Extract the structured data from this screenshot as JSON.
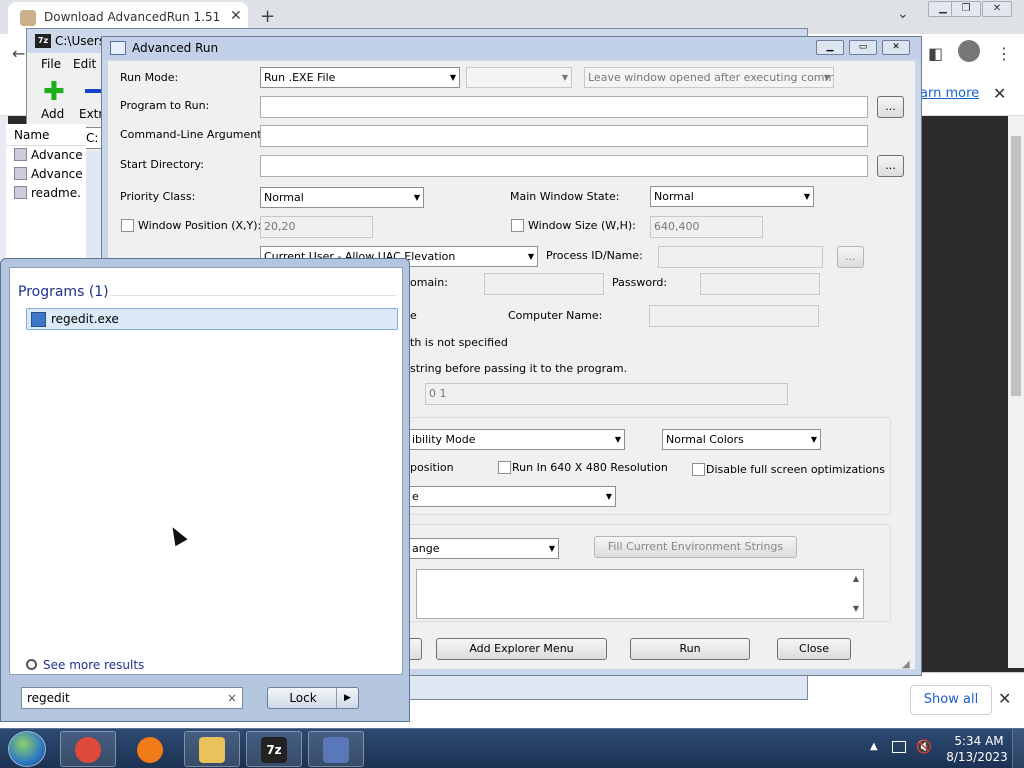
{
  "chrome": {
    "tab_title": "Download AdvancedRun 1.51",
    "tab_close": "✕",
    "new_tab": "+",
    "tab_search": "⌄",
    "infobar_link": "earn more",
    "infobar_close": "✕",
    "show_all": "Show all",
    "shelf_close": "✕"
  },
  "zip": {
    "title": "C:\\Users\\",
    "menu": [
      "File",
      "Edit"
    ],
    "add_label": "Add",
    "extract_label": "Extra",
    "path": "C:",
    "col_name": "Name",
    "files": [
      "Advance",
      "Advance",
      "readme."
    ]
  },
  "advanced_run": {
    "title": "Advanced Run",
    "run_mode_label": "Run Mode:",
    "run_mode_value": "Run .EXE File",
    "after_exec_value": "Leave window opened after executing comman",
    "program_label": "Program to Run:",
    "program_value": "",
    "browse1": "...",
    "args_label": "Command-Line Arguments:",
    "args_value": "",
    "start_dir_label": "Start Directory:",
    "start_dir_value": "",
    "browse2": "...",
    "priority_label": "Priority Class:",
    "priority_value": "Normal",
    "main_state_label": "Main Window State:",
    "main_state_value": "Normal",
    "win_pos_label": "Window Position (X,Y):",
    "win_pos_value": "20,20",
    "win_size_label": "Window Size (W,H):",
    "win_size_value": "640,400",
    "run_as_value": "Current User - Allow UAC Elevation",
    "process_label": "Process ID/Name:",
    "process_value": "",
    "browse3": "...",
    "domain_label": "omain:",
    "domain_value": "",
    "password_label": "Password:",
    "password_value": "",
    "computer_label": "Computer Name:",
    "computer_value": "",
    "partial_e": "e",
    "not_specified_text": "th is not specified",
    "string_before_text": "string before passing it to the program.",
    "affinity_value": "0 1",
    "compat_value": "ibility Mode",
    "colors_value": "Normal Colors",
    "position_text": "position",
    "res640_label": "Run In 640 X 480 Resolution",
    "disable_fs_label": "Disable full screen optimizations",
    "dpi_value": "e",
    "env_value": "ange",
    "fill_env_button": "Fill Current Environment Strings",
    "add_explorer_button": "Add Explorer Menu",
    "run_button": "Run",
    "close_button": "Close"
  },
  "start_menu": {
    "programs_header": "Programs (1)",
    "result": "regedit.exe",
    "see_more": "See more results",
    "search_value": "regedit",
    "search_clear": "×",
    "lock_label": "Lock",
    "lock_arrow": "▶"
  },
  "taskbar": {
    "time": "5:34 AM",
    "date": "8/13/2023",
    "zip_label": "7z"
  },
  "colors": {
    "chrome_icon": "#e04a3a",
    "firefox_icon": "#f07b18",
    "explorer_icon": "#e8c25a",
    "zip_icon": "#222222",
    "advrun_icon": "#5a78b8"
  }
}
